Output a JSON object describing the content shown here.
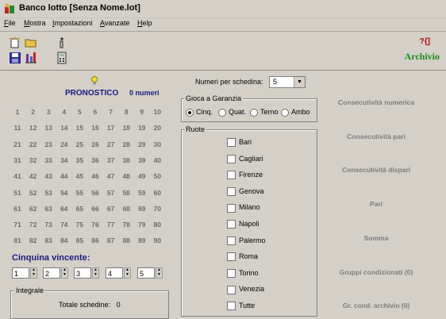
{
  "window": {
    "title": "Banco lotto [Senza Nome.lot]"
  },
  "menu": [
    {
      "key": "F",
      "rest": "ile"
    },
    {
      "key": "M",
      "rest": "ostra"
    },
    {
      "key": "I",
      "rest": "mpostazioni"
    },
    {
      "key": "A",
      "rest": "vanzate"
    },
    {
      "key": "H",
      "rest": "elp"
    }
  ],
  "toolbar": {
    "archivio_label": "Archivio",
    "archivio_icon_text": "?{]"
  },
  "pronostico": {
    "title": "PRONOSTICO",
    "count": "0 numeri"
  },
  "numbers": [
    [
      "1",
      "2",
      "3",
      "4",
      "5",
      "6",
      "7",
      "8",
      "9",
      "10"
    ],
    [
      "11",
      "12",
      "13",
      "14",
      "15",
      "16",
      "17",
      "18",
      "19",
      "20"
    ],
    [
      "21",
      "22",
      "23",
      "24",
      "25",
      "26",
      "27",
      "28",
      "29",
      "30"
    ],
    [
      "31",
      "32",
      "33",
      "34",
      "35",
      "36",
      "37",
      "38",
      "39",
      "40"
    ],
    [
      "41",
      "42",
      "43",
      "44",
      "45",
      "46",
      "47",
      "48",
      "49",
      "50"
    ],
    [
      "51",
      "52",
      "53",
      "54",
      "55",
      "56",
      "57",
      "58",
      "59",
      "60"
    ],
    [
      "61",
      "62",
      "63",
      "64",
      "65",
      "66",
      "67",
      "68",
      "69",
      "70"
    ],
    [
      "71",
      "72",
      "73",
      "74",
      "75",
      "76",
      "77",
      "78",
      "79",
      "80"
    ],
    [
      "81",
      "82",
      "83",
      "84",
      "85",
      "86",
      "87",
      "88",
      "89",
      "90"
    ]
  ],
  "cinquina": {
    "title": "Cinquina vincente:",
    "values": [
      "1",
      "2",
      "3",
      "4",
      "5"
    ]
  },
  "integrale": {
    "title": "Integrale",
    "totale_label": "Totale schedine:",
    "totale_value": "0"
  },
  "numeri_per_schedina": {
    "label": "Numeri per schedina:",
    "value": "5"
  },
  "garanzia": {
    "title": "Gioca a Garanzia",
    "options": [
      "Cinq.",
      "Quat.",
      "Terno",
      "Ambo"
    ],
    "selected": "Cinq."
  },
  "ruote": {
    "title": "Ruote",
    "items": [
      "Bari",
      "Cagliari",
      "Firenze",
      "Genova",
      "Milano",
      "Napoli",
      "Palermo",
      "Roma",
      "Torino",
      "Venezia",
      "Tutte"
    ]
  },
  "right_buttons": [
    "Consecutività numerica",
    "Consecutività pari",
    "Consecutività dispari",
    "Pari",
    "Somma",
    "Gruppi condizionati (0)",
    "Gr. cond. archivio (0)"
  ]
}
